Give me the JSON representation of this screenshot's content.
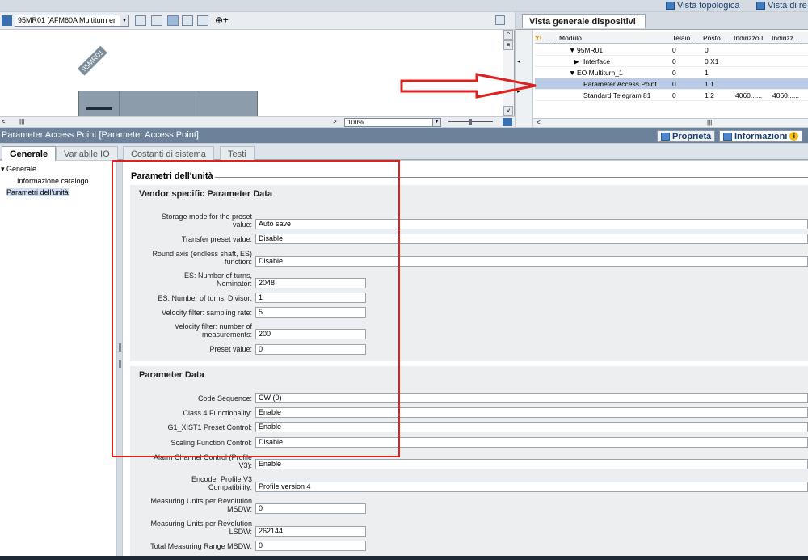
{
  "top_views": {
    "topology": "Vista topologica",
    "network": "Vista di re"
  },
  "device_view": {
    "device_selector": "95MR01 [AFM60A Multiturn er",
    "device_label": "95MR01",
    "zoom": "100%"
  },
  "overview": {
    "tab_label": "Vista generale dispositivi",
    "columns": [
      "...",
      "Modulo",
      "Telaio...",
      "Posto ...",
      "Indirizzo I",
      "Indirizz..."
    ],
    "rows": [
      {
        "modulo": "95MR01",
        "telaio": "0",
        "posto": "0",
        "ind_i": "",
        "ind_q": "",
        "indent": 1,
        "expander": "▼"
      },
      {
        "modulo": "Interface",
        "telaio": "0",
        "posto": "0 X1",
        "ind_i": "",
        "ind_q": "",
        "indent": 2,
        "expander": "▶"
      },
      {
        "modulo": "EO Multiturn_1",
        "telaio": "0",
        "posto": "1",
        "ind_i": "",
        "ind_q": "",
        "indent": 1,
        "expander": "▼"
      },
      {
        "modulo": "Parameter Access Point",
        "telaio": "0",
        "posto": "1 1",
        "ind_i": "",
        "ind_q": "",
        "indent": 3,
        "expander": "",
        "selected": true
      },
      {
        "modulo": "Standard Telegram 81",
        "telaio": "0",
        "posto": "1 2",
        "ind_i": "4060......",
        "ind_q": "4060......",
        "indent": 3,
        "expander": ""
      }
    ]
  },
  "properties": {
    "title": "Parameter Access Point [Parameter Access Point]",
    "tab_proprieta": "Proprietà",
    "tab_informazioni": "Informazioni",
    "tabs": [
      "Generale",
      "Variabile IO",
      "Costanti di sistema",
      "Testi"
    ]
  },
  "nav": {
    "generale": "Generale",
    "catalog_info": "Informazione catalogo",
    "unit_params": "Parametri dell'unità"
  },
  "section_title": "Parametri dell'unità",
  "vendor_group": {
    "title": "Vendor specific Parameter Data",
    "params": [
      {
        "label_lines": [
          "Storage mode for the preset",
          "value:"
        ],
        "value": "Auto save",
        "type": "select"
      },
      {
        "label_lines": [
          "Transfer preset value:"
        ],
        "value": "Disable",
        "type": "select"
      },
      {
        "label_lines": [
          "Round axis (endless shaft, ES)",
          "function:"
        ],
        "value": "Disable",
        "type": "select"
      },
      {
        "label_lines": [
          "ES: Number of turns,",
          "Nominator:"
        ],
        "value": "2048",
        "type": "input"
      },
      {
        "label_lines": [
          "ES: Number of turns, Divisor:"
        ],
        "value": "1",
        "type": "input"
      },
      {
        "label_lines": [
          "Velocity filter: sampling rate:"
        ],
        "value": "5",
        "type": "input"
      },
      {
        "label_lines": [
          "Velocity filter: number of",
          "measurements:"
        ],
        "value": "200",
        "type": "input"
      },
      {
        "label_lines": [
          "Preset value:"
        ],
        "value": "0",
        "type": "input"
      }
    ]
  },
  "param_group": {
    "title": "Parameter Data",
    "params": [
      {
        "label_lines": [
          "Code Sequence:"
        ],
        "value": "CW (0)",
        "type": "select"
      },
      {
        "label_lines": [
          "Class 4 Functionality:"
        ],
        "value": "Enable",
        "type": "select"
      },
      {
        "label_lines": [
          "G1_XIST1 Preset Control:"
        ],
        "value": "Enable",
        "type": "select"
      },
      {
        "label_lines": [
          "Scaling Function Control:"
        ],
        "value": "Disable",
        "type": "select"
      },
      {
        "label_lines": [
          "Alarm Channel Control (Profile",
          "V3):"
        ],
        "value": "Enable",
        "type": "select"
      },
      {
        "label_lines": [
          "Encoder Profile V3",
          "Compatibility:"
        ],
        "value": "Profile version 4",
        "type": "select"
      },
      {
        "label_lines": [
          "Measuring Units per Revolution",
          "MSDW:"
        ],
        "value": "0",
        "type": "input"
      },
      {
        "label_lines": [
          "Measuring Units per Revolution",
          "LSDW:"
        ],
        "value": "262144",
        "type": "input"
      },
      {
        "label_lines": [
          "Total Measuring Range MSDW:"
        ],
        "value": "0",
        "type": "input"
      }
    ]
  }
}
